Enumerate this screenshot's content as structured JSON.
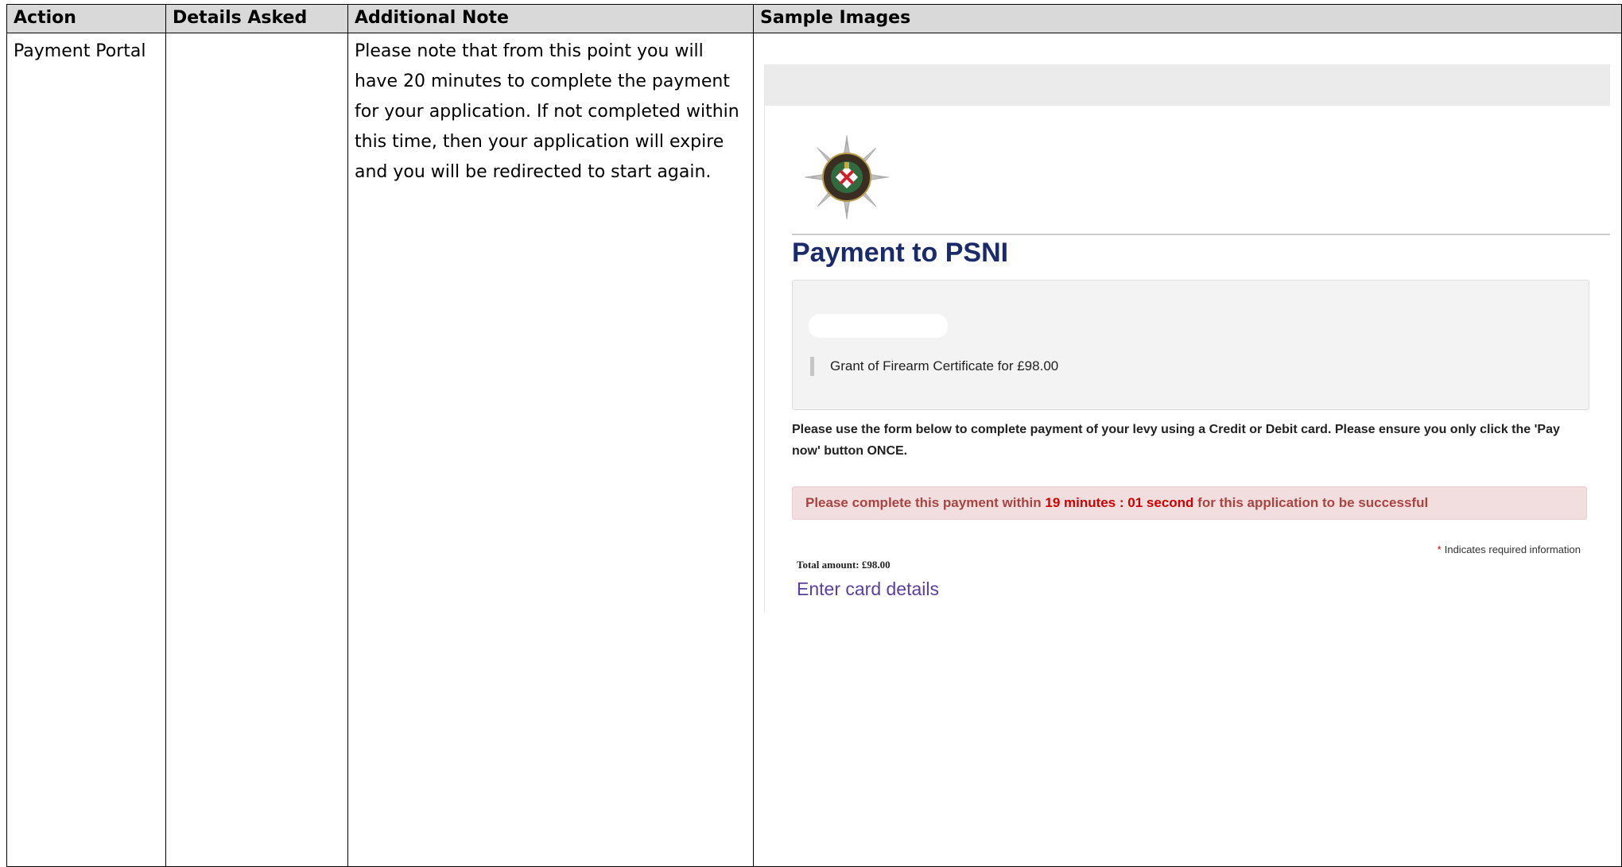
{
  "table": {
    "headers": [
      "Action",
      "Details Asked",
      "Additional Note",
      "Sample Images"
    ],
    "row": {
      "action": "Payment Portal",
      "details": "",
      "note_lines": [
        "Please note that from this point you will",
        "have 20 minutes to complete the payment",
        "for your application. If not completed within",
        "this time, then your application will expire",
        "and you will be redirected to start again."
      ]
    }
  },
  "sample": {
    "heading": "Payment to PSNI",
    "summary_item": "Grant of Firearm Certificate for £98.00",
    "instructions": "Please use the form below to complete payment of your levy using a Credit or Debit card. Please ensure you only click the 'Pay now' button ONCE.",
    "timer": {
      "prefix": "Please complete this payment within ",
      "remaining": "19 minutes : 01 second",
      "suffix": " for this application to be successful"
    },
    "required_star": "*",
    "required_note": "Indicates required information",
    "total_amount": "Total amount: £98.00",
    "card_heading": "Enter card details",
    "crest_icon": "psni-crest-icon",
    "colors": {
      "heading": "#1b2a6b",
      "alert_bg": "#f2dede",
      "alert_text": "#a94442",
      "alert_emphasis": "#d10000",
      "link": "#5b3fa0"
    }
  }
}
